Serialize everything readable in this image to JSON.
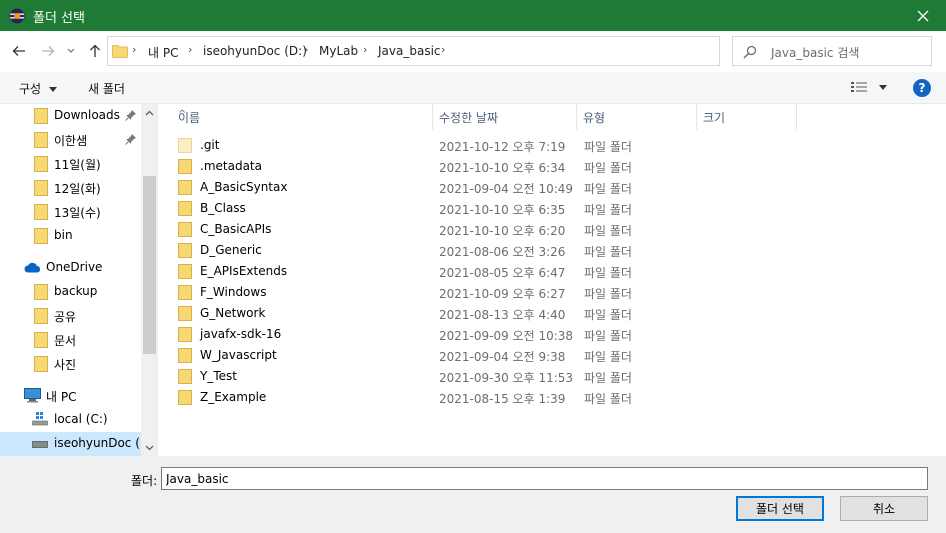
{
  "window": {
    "title": "폴더 선택"
  },
  "nav": {
    "breadcrumb": [
      "내 PC",
      "iseohyunDoc (D:)",
      "MyLab",
      "Java_basic"
    ],
    "search_placeholder": "Java_basic 검색"
  },
  "toolbar": {
    "organize": "구성",
    "new_folder": "새 폴더"
  },
  "sidebar": {
    "items": [
      {
        "label": "Downloads",
        "icon": "folder-icon",
        "pinned": true
      },
      {
        "label": "이한샘",
        "icon": "folder-icon",
        "pinned": true
      },
      {
        "label": "11일(월)",
        "icon": "folder-icon"
      },
      {
        "label": "12일(화)",
        "icon": "folder-icon"
      },
      {
        "label": "13일(수)",
        "icon": "folder-icon"
      },
      {
        "label": "bin",
        "icon": "folder-icon"
      },
      {
        "label": "OneDrive",
        "icon": "cloud-icon"
      },
      {
        "label": "backup",
        "icon": "folder-icon"
      },
      {
        "label": "공유",
        "icon": "folder-icon"
      },
      {
        "label": "문서",
        "icon": "folder-icon"
      },
      {
        "label": "사진",
        "icon": "folder-icon"
      },
      {
        "label": "내 PC",
        "icon": "computer-icon"
      },
      {
        "label": "local (C:)",
        "icon": "drive-icon"
      },
      {
        "label": "iseohyunDoc (D",
        "icon": "drive-icon",
        "selected": true
      }
    ]
  },
  "columns": {
    "name": "이름",
    "date": "수정한 날짜",
    "type": "유형",
    "size": "크기"
  },
  "files": [
    {
      "name": ".git",
      "date": "2021-10-12 오후 7:19",
      "type": "파일 폴더",
      "faded": true
    },
    {
      "name": ".metadata",
      "date": "2021-10-10 오후 6:34",
      "type": "파일 폴더"
    },
    {
      "name": "A_BasicSyntax",
      "date": "2021-09-04 오전 10:49",
      "type": "파일 폴더"
    },
    {
      "name": "B_Class",
      "date": "2021-10-10 오후 6:35",
      "type": "파일 폴더"
    },
    {
      "name": "C_BasicAPIs",
      "date": "2021-10-10 오후 6:20",
      "type": "파일 폴더"
    },
    {
      "name": "D_Generic",
      "date": "2021-08-06 오전 3:26",
      "type": "파일 폴더"
    },
    {
      "name": "E_APIsExtends",
      "date": "2021-08-05 오후 6:47",
      "type": "파일 폴더"
    },
    {
      "name": "F_Windows",
      "date": "2021-10-09 오후 6:27",
      "type": "파일 폴더"
    },
    {
      "name": "G_Network",
      "date": "2021-08-13 오후 4:40",
      "type": "파일 폴더"
    },
    {
      "name": "javafx-sdk-16",
      "date": "2021-09-09 오전 10:38",
      "type": "파일 폴더"
    },
    {
      "name": "W_Javascript",
      "date": "2021-09-04 오전 9:38",
      "type": "파일 폴더"
    },
    {
      "name": "Y_Test",
      "date": "2021-09-30 오후 11:53",
      "type": "파일 폴더"
    },
    {
      "name": "Z_Example",
      "date": "2021-08-15 오후 1:39",
      "type": "파일 폴더"
    }
  ],
  "footer": {
    "folder_label": "폴더:",
    "folder_value": "Java_basic",
    "select_button": "폴더 선택",
    "cancel_button": "취소"
  },
  "colors": {
    "titlebar": "#1e7a35",
    "selection": "#cce8ff",
    "folder": "#f8d775",
    "accent": "#0078d7"
  }
}
